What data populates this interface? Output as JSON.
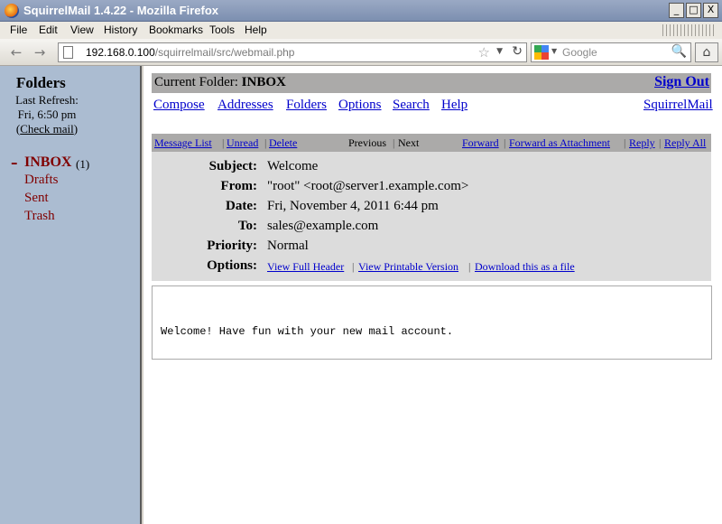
{
  "window": {
    "title": "SquirrelMail 1.4.22 - Mozilla Firefox",
    "buttons": [
      "_",
      "□",
      "X"
    ]
  },
  "menu": [
    {
      "label": "File",
      "mnemonic": "F"
    },
    {
      "label": "Edit",
      "mnemonic": "E"
    },
    {
      "label": "View",
      "mnemonic": "V"
    },
    {
      "label": "History",
      "mnemonic": "s"
    },
    {
      "label": "Bookmarks",
      "mnemonic": "B"
    },
    {
      "label": "Tools",
      "mnemonic": "T"
    },
    {
      "label": "Help",
      "mnemonic": "H"
    }
  ],
  "nav": {
    "url_host": "192.168.0.100",
    "url_path": "/squirrelmail/src/webmail.php",
    "search_placeholder": "Google"
  },
  "folders": {
    "title": "Folders",
    "last_refresh_label": "Last Refresh:",
    "last_refresh_time": "Fri, 6:50 pm",
    "check_mail": "Check mail",
    "inbox_label": "INBOX",
    "inbox_count": "(1)",
    "items": [
      "Drafts",
      "Sent",
      "Trash"
    ]
  },
  "header": {
    "current_folder_label": "Current Folder:",
    "current_folder": "INBOX",
    "sign_out": "Sign Out",
    "links": [
      "Compose",
      "Addresses",
      "Folders",
      "Options",
      "Search",
      "Help"
    ],
    "brand_link": "SquirrelMail"
  },
  "message_bar": {
    "message_list": "Message List",
    "unread": "Unread",
    "delete": "Delete",
    "previous": "Previous",
    "next": "Next",
    "forward": "Forward",
    "forward_attachment": "Forward as Attachment",
    "reply": "Reply",
    "reply_all": "Reply All"
  },
  "message": {
    "subject_label": "Subject:",
    "subject": "Welcome",
    "from_label": "From:",
    "from": "\"root\" <root@server1.example.com>",
    "date_label": "Date:",
    "date": "Fri, November 4, 2011 6:44 pm",
    "to_label": "To:",
    "to": "sales@example.com",
    "priority_label": "Priority:",
    "priority": "Normal",
    "options_label": "Options:",
    "options": [
      "View Full Header",
      "View Printable Version",
      "Download this as a file"
    ],
    "body": "Welcome! Have fun with your new mail account."
  },
  "colors": {
    "folder_pane": "#abbcd1",
    "header_bar": "#abaaa9",
    "header_box": "#dcdcdc",
    "link": "#0000cc",
    "folder_text": "#800000"
  }
}
